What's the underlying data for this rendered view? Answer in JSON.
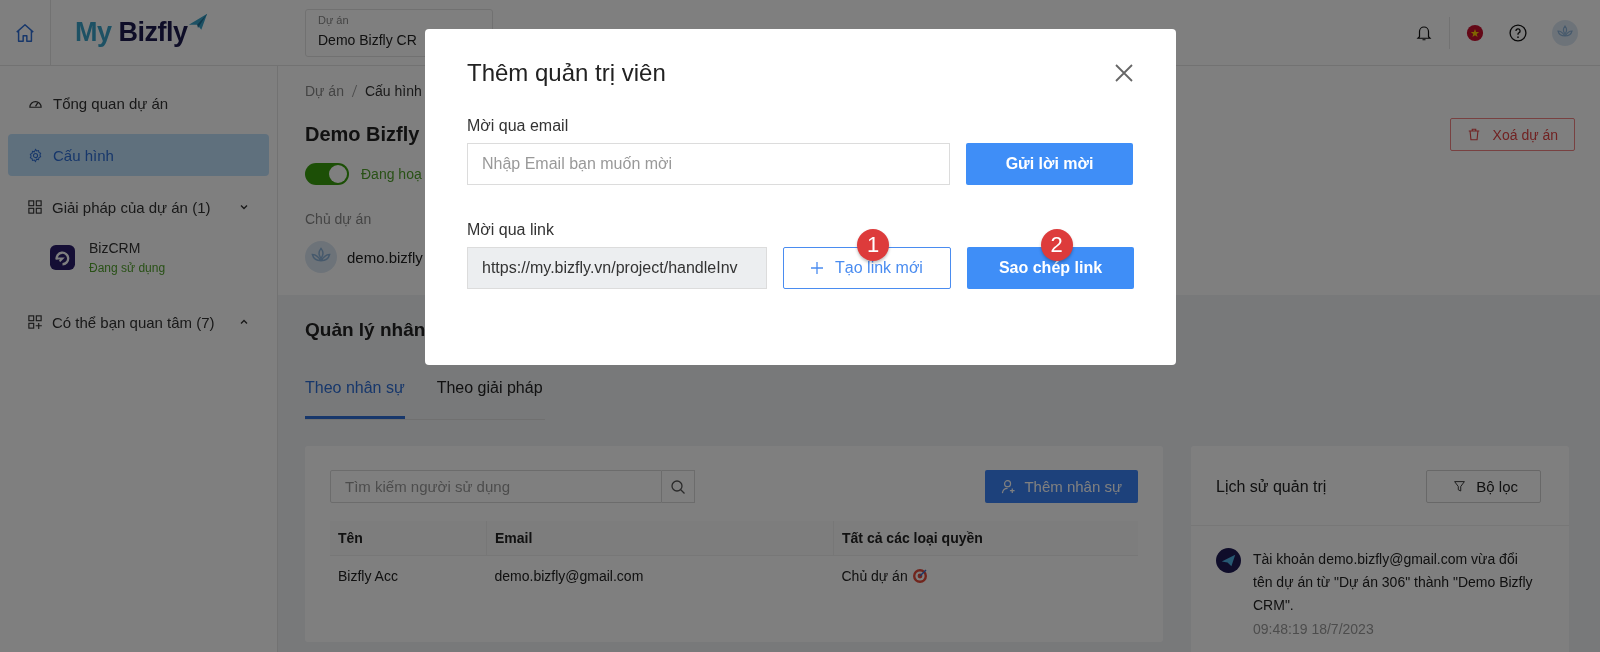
{
  "header": {
    "logo": {
      "prefix": "My",
      "brand": "Bizfly"
    },
    "project_selector": {
      "label": "Dự án",
      "value": "Demo Bizfly CR"
    }
  },
  "sidebar": {
    "items": [
      {
        "kind": "link",
        "label": "Tổng quan dự án",
        "selected": false
      },
      {
        "kind": "link",
        "label": "Cấu hình",
        "selected": true
      },
      {
        "kind": "group",
        "label": "Giải pháp của dự án (1)",
        "expanded": true,
        "children": [
          {
            "name": "BizCRM",
            "status": "Đang sử dụng"
          }
        ]
      },
      {
        "kind": "group",
        "label": "Có thể bạn quan tâm (7)",
        "expanded": false
      }
    ]
  },
  "breadcrumb": [
    "Dự án",
    "Cấu hình"
  ],
  "project": {
    "title": "Demo Bizfly",
    "active": true,
    "status": "Đang hoạ",
    "owner_label": "Chủ dự án",
    "owner": "demo.bizfly",
    "delete_button": "Xoá dự án"
  },
  "staff": {
    "title": "Quản lý nhân",
    "tabs": [
      {
        "label": "Theo nhân sự",
        "selected": true
      },
      {
        "label": "Theo giải pháp",
        "selected": false
      }
    ],
    "search": {
      "placeholder": "Tìm kiếm người sử dụng"
    },
    "add_button": "Thêm nhân sự",
    "table": {
      "columns": [
        "Tên",
        "Email",
        "Tất cả các loại quyền"
      ],
      "rows": [
        {
          "name": "Bizfly Acc",
          "email": "demo.bizfly@gmail.com",
          "role": "Chủ dự án"
        }
      ]
    }
  },
  "history": {
    "title": "Lịch sử quản trị",
    "filter_button": "Bộ lọc",
    "entries": [
      {
        "text": "Tài khoản demo.bizfly@gmail.com vừa đổi tên dự án từ \"Dự án 306\" thành \"Demo Bizfly CRM\".",
        "time": "09:48:19 18/7/2023"
      }
    ]
  },
  "modal": {
    "title": "Thêm quản trị viên",
    "email_label": "Mời qua email",
    "email": {
      "placeholder": "Nhập Email bạn muốn mời"
    },
    "send_button": {
      "label": "Gửi lời mời"
    },
    "link_label": "Mời qua link",
    "link": {
      "value": "https://my.bizfly.vn/project/handleInv"
    },
    "new_link_button": {
      "label": "Tạo link mới",
      "badge": "1"
    },
    "copy_button": {
      "label": "Sao chép link",
      "badge": "2"
    }
  }
}
